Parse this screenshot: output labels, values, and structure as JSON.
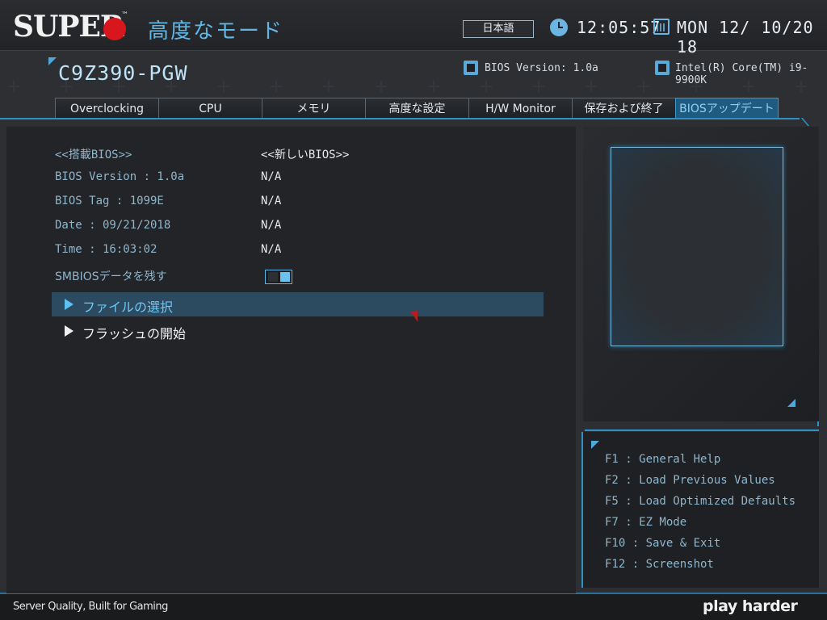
{
  "header": {
    "logo_text": "SUPER",
    "logo_tm": "™",
    "mode_title": "高度なモード",
    "language": "日本語",
    "time": "12:05:57",
    "date": "MON  12/ 10/20 18"
  },
  "system": {
    "model": "C9Z390-PGW",
    "bios_version_label": "BIOS Version: 1.0a",
    "cpu": "Intel(R) Core(TM) i9-9900K"
  },
  "tabs": [
    {
      "label": "Overclocking",
      "active": false
    },
    {
      "label": "CPU",
      "active": false
    },
    {
      "label": "メモリ",
      "active": false
    },
    {
      "label": "高度な設定",
      "active": false
    },
    {
      "label": "H/W Monitor",
      "active": false
    },
    {
      "label": "保存および終了",
      "active": false
    },
    {
      "label": "BIOSアップデート",
      "active": true
    }
  ],
  "bios_info": {
    "current_header": "<<搭載BIOS>>",
    "new_header": "<<新しいBIOS>>",
    "rows": [
      {
        "label": "BIOS Version : 1.0a",
        "new_value": "N/A"
      },
      {
        "label": "BIOS Tag : 1099E",
        "new_value": "N/A"
      },
      {
        "label": "Date : 09/21/2018",
        "new_value": "N/A"
      },
      {
        "label": "Time : 16:03:02",
        "new_value": "N/A"
      }
    ],
    "smbios_label": "SMBIOSデータを残す",
    "smbios_enabled": true
  },
  "actions": {
    "select_file": "ファイルの選択",
    "start_flash": "フラッシュの開始"
  },
  "help": [
    "F1  : General Help",
    "F2  : Load Previous Values",
    "F5  : Load Optimized Defaults",
    "F7  : EZ Mode",
    "F10 : Save & Exit",
    "F12 : Screenshot"
  ],
  "footer": {
    "slogan": "Server Quality, Built for Gaming",
    "tagline": "play harder"
  },
  "colors": {
    "accent": "#4fa8dc",
    "active_tab_bg": "#1f5b80",
    "logo_red": "#d8161e"
  }
}
